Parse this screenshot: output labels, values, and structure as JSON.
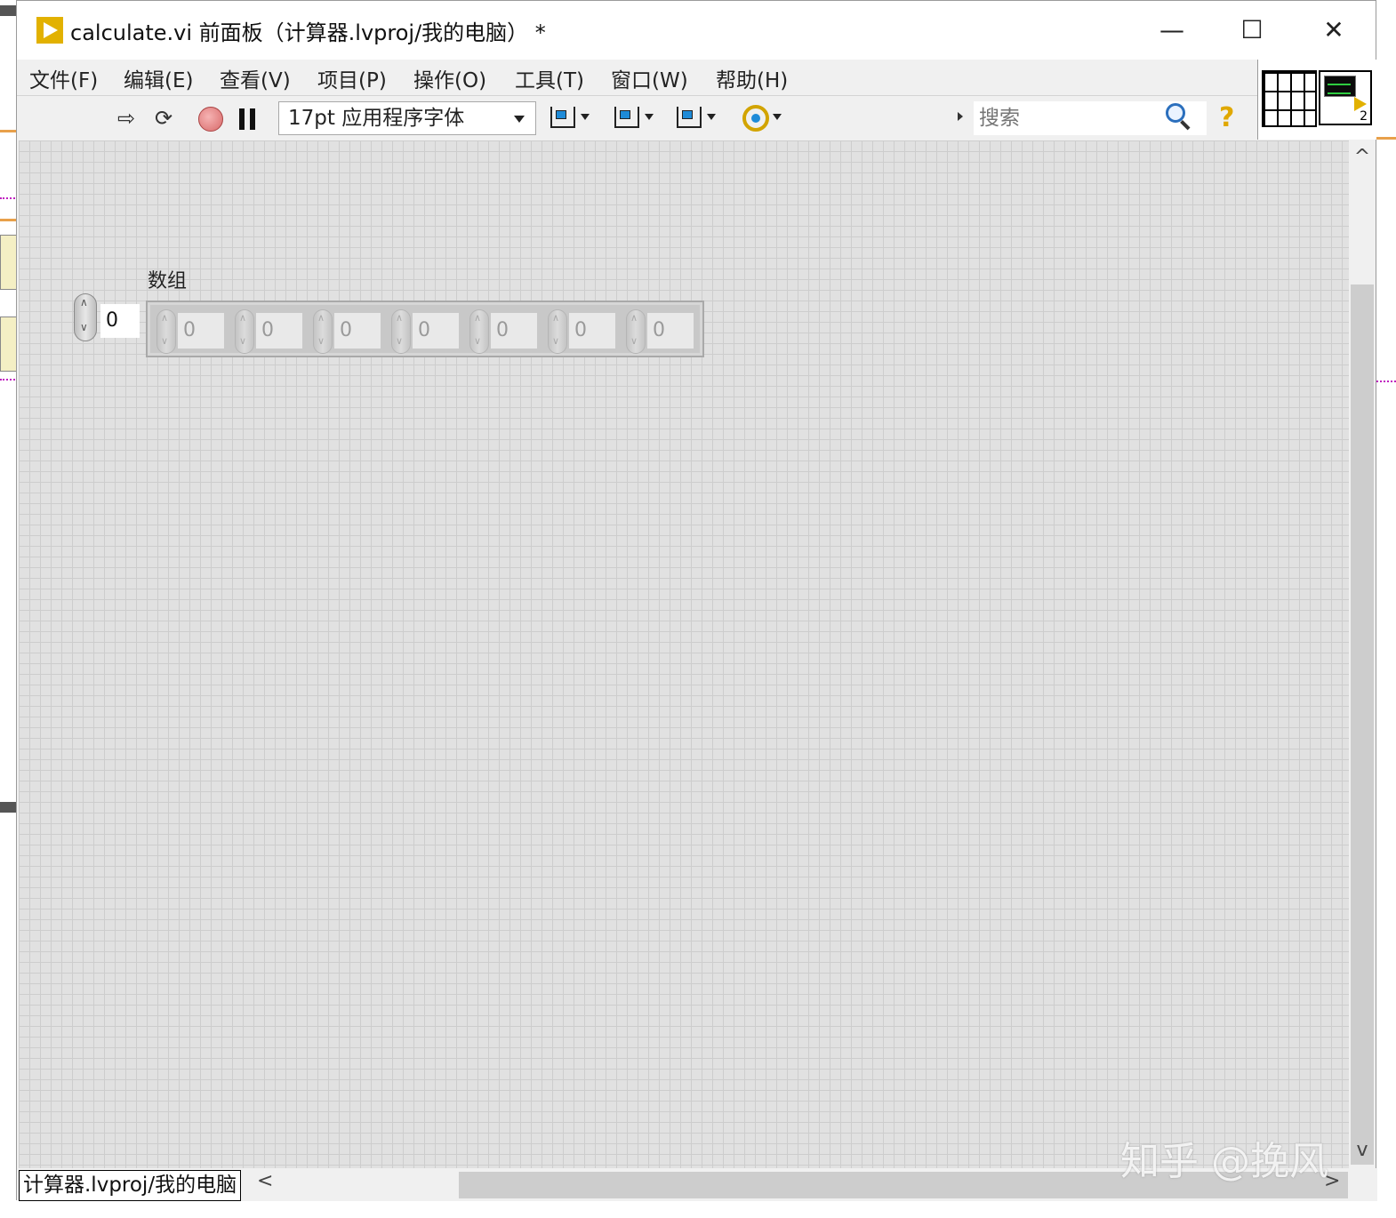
{
  "window": {
    "title": "calculate.vi 前面板（计算器.lvproj/我的电脑） *",
    "minimize_glyph": "—",
    "maximize_glyph": "☐",
    "close_glyph": "✕"
  },
  "menu": [
    "文件(F)",
    "编辑(E)",
    "查看(V)",
    "项目(P)",
    "操作(O)",
    "工具(T)",
    "窗口(W)",
    "帮助(H)"
  ],
  "toolbar": {
    "run_glyph": "⇨",
    "run_continuously_glyph": "⟳",
    "font_select": "17pt 应用程序字体",
    "search_placeholder": "搜索",
    "help_glyph": "?",
    "icons": [
      "run-arrow-icon",
      "run-continuously-icon",
      "abort-icon",
      "pause-icon",
      "align-objects-icon",
      "distribute-objects-icon",
      "resize-objects-icon",
      "reorder-icon",
      "search-icon",
      "help-icon"
    ]
  },
  "connector_pane": {
    "vi_icon_number": "2"
  },
  "front_panel": {
    "array": {
      "label": "数组",
      "index": "0",
      "elements": [
        "0",
        "0",
        "0",
        "0",
        "0",
        "0",
        "0"
      ]
    }
  },
  "statusbar": {
    "context": "计算器.lvproj/我的电脑",
    "scroll_left_glyph": "<",
    "scroll_right_glyph": ">"
  },
  "scrollbar": {
    "up_glyph": "^",
    "down_glyph": "v"
  },
  "watermark": "知乎 @挽风",
  "colors": {
    "panel_background": "#e1e1e1",
    "grid_line": "#cdcdcd",
    "labview_yellow": "#e2b100"
  }
}
